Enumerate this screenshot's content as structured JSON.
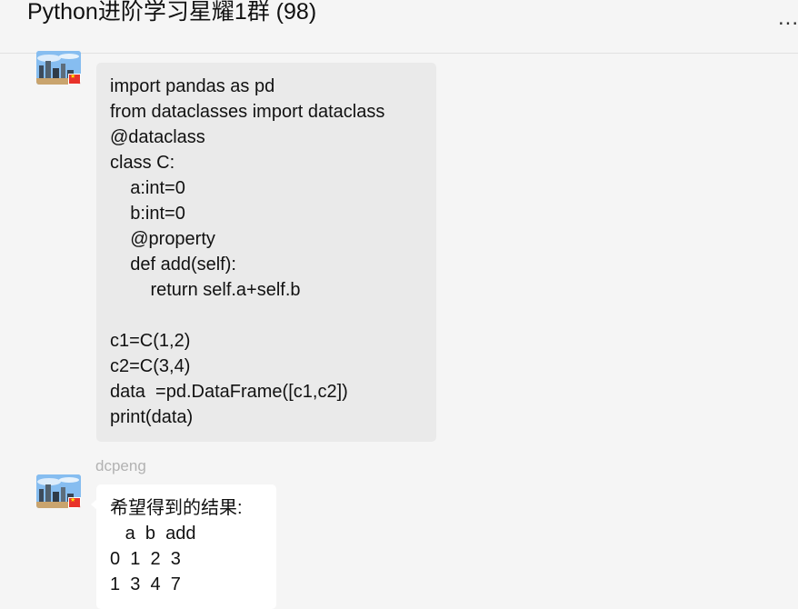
{
  "header": {
    "title": "Python进阶学习星耀1群 (98)",
    "more_label": "...",
    "more_icon": "more-dots-icon"
  },
  "messages": [
    {
      "sender": "",
      "text": "import pandas as pd\nfrom dataclasses import dataclass\n@dataclass\nclass C:\n    a:int=0\n    b:int=0\n    @property\n    def add(self):\n        return self.a+self.b\n\nc1=C(1,2)\nc2=C(3,4)\ndata  =pd.DataFrame([c1,c2])\nprint(data)"
    },
    {
      "sender": "dcpeng",
      "text": "希望得到的结果:\n   a  b  add\n0  1  2  3\n1  3  4  7"
    }
  ],
  "colors": {
    "background": "#f5f5f5",
    "bubble_gray": "#eaeaea",
    "bubble_white": "#ffffff",
    "sender_name": "#b2b2b2"
  }
}
